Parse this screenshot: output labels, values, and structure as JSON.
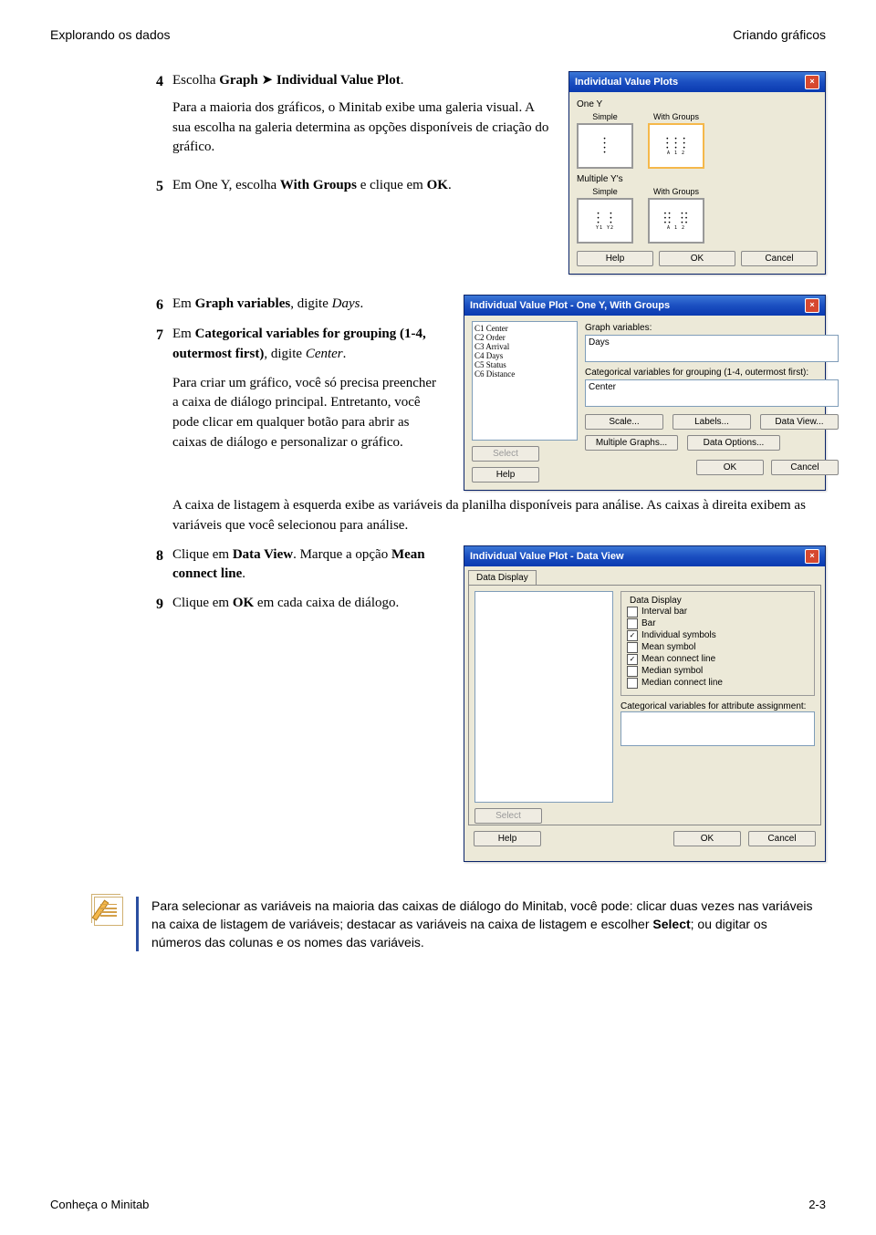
{
  "header": {
    "left": "Explorando os dados",
    "right": "Criando gráficos"
  },
  "steps": {
    "s4": {
      "num": "4",
      "line1_a": "Escolha ",
      "line1_b": "Graph",
      "line1_c": " ➤ ",
      "line1_d": "Individual Value Plot",
      "line1_e": ".",
      "p1": "Para a maioria dos gráficos, o Minitab exibe uma galeria visual. A sua escolha na galeria determina as opções disponíveis de criação do gráfico."
    },
    "s5": {
      "num": "5",
      "a": "Em One Y, escolha ",
      "b": "With Groups",
      "c": " e clique em ",
      "d": "OK",
      "e": "."
    },
    "s6": {
      "num": "6",
      "a": "Em ",
      "b": "Graph variables",
      "c": ", digite ",
      "d": "Days",
      "e": "."
    },
    "s7": {
      "num": "7",
      "a": "Em ",
      "b": "Categorical variables for grouping (1-4, outermost first)",
      "c": ", digite ",
      "d": "Center",
      "e": ".",
      "p1": "Para criar um gráfico, você só precisa preencher a caixa de diálogo principal. Entretanto, você pode clicar em qualquer botão para abrir as caixas de diálogo e personalizar o gráfico.",
      "p2": "A caixa de listagem à esquerda exibe as variáveis da planilha disponíveis para análise. As caixas à direita exibem as variáveis que você selecionou para análise."
    },
    "s8": {
      "num": "8",
      "a": "Clique em ",
      "b": "Data View",
      "c": ". Marque a opção ",
      "d": "Mean connect line",
      "e": "."
    },
    "s9": {
      "num": "9",
      "a": "Clique em ",
      "b": "OK",
      "c": " em cada caixa de diálogo."
    }
  },
  "dlg1": {
    "title": "Individual Value Plots",
    "sec1": "One Y",
    "sec2": "Multiple Y's",
    "c_simple": "Simple",
    "c_withgroups": "With Groups",
    "axis_a": "A  1  2",
    "axis_y": "Y1  Y2",
    "help": "Help",
    "ok": "OK",
    "cancel": "Cancel"
  },
  "dlg2": {
    "title": "Individual Value Plot - One Y, With Groups",
    "vars": [
      "C1    Center",
      "C2    Order",
      "C3    Arrival",
      "C4    Days",
      "C5    Status",
      "C6    Distance"
    ],
    "lbl_graphvars": "Graph variables:",
    "val_graphvars": "Days",
    "lbl_catvars": "Categorical variables for grouping (1-4, outermost first):",
    "val_catvars": "Center",
    "btn_scale": "Scale...",
    "btn_labels": "Labels...",
    "btn_dataview": "Data View...",
    "btn_multgraphs": "Multiple Graphs...",
    "btn_dataoptions": "Data Options...",
    "btn_select": "Select",
    "help": "Help",
    "ok": "OK",
    "cancel": "Cancel"
  },
  "dlg3": {
    "title": "Individual Value Plot - Data View",
    "tab": "Data Display",
    "group_title": "Data Display",
    "opts": [
      {
        "label": "Interval bar",
        "checked": false,
        "u": "I"
      },
      {
        "label": "Bar",
        "checked": false,
        "u": "B"
      },
      {
        "label": "Individual symbols",
        "checked": true,
        "u": "n"
      },
      {
        "label": "Mean symbol",
        "checked": false,
        "u": "M"
      },
      {
        "label": "Mean connect line",
        "checked": true,
        "u": "e"
      },
      {
        "label": "Median symbol",
        "checked": false,
        "u": "d"
      },
      {
        "label": "Median connect line",
        "checked": false,
        "u": "c"
      }
    ],
    "lbl_catattr": "Categorical variables for attribute assignment:",
    "btn_select": "Select",
    "help": "Help",
    "ok": "OK",
    "cancel": "Cancel"
  },
  "note": {
    "text": "Para selecionar as variáveis na maioria das caixas de diálogo do Minitab, você pode: clicar duas vezes nas variáveis na caixa de listagem de variáveis; destacar as variáveis na caixa de listagem e escolher ",
    "bold": "Select",
    "text2": "; ou digitar os números das colunas e os nomes das variáveis."
  },
  "footer": {
    "left": "Conheça o Minitab",
    "right": "2-3"
  }
}
